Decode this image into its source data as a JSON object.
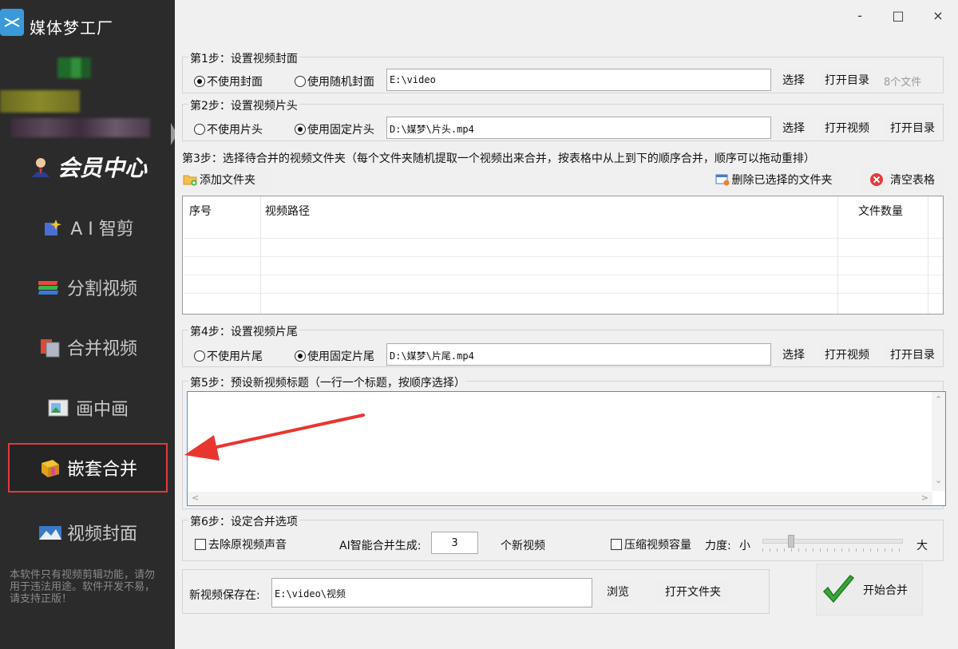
{
  "app": {
    "title": "媒体梦工厂",
    "logo_icon": "scissors-logo-icon"
  },
  "sidebar": {
    "vip_label": "会员中心",
    "items": [
      {
        "label": "A I 智剪",
        "icon": "ai-magic-icon"
      },
      {
        "label": "分割视频",
        "icon": "split-video-icon"
      },
      {
        "label": "合并视频",
        "icon": "merge-video-icon"
      },
      {
        "label": "画中画",
        "icon": "picture-in-picture-icon"
      },
      {
        "label": "嵌套合并",
        "icon": "nested-merge-icon",
        "active": true
      },
      {
        "label": "视频封面",
        "icon": "video-cover-icon"
      }
    ],
    "note": "本软件只有视频剪辑功能，请勿用于违法用途。软件开发不易，请支持正版！"
  },
  "window_controls": {
    "minimize": "-",
    "maximize": "□",
    "close": "×"
  },
  "step1": {
    "legend": "第1步：设置视频封面",
    "option_none": "不使用封面",
    "option_random": "使用随机封面",
    "selected": "option_none",
    "path": "E:\\video",
    "select_label": "选择",
    "open_dir_label": "打开目录",
    "file_count_hint": "8个文件"
  },
  "step2": {
    "legend": "第2步：设置视频片头",
    "option_none": "不使用片头",
    "option_fixed": "使用固定片头",
    "selected": "option_fixed",
    "path": "D:\\媒梦\\片头.mp4",
    "select_label": "选择",
    "open_video_label": "打开视频",
    "open_dir_label": "打开目录"
  },
  "step3": {
    "label": "第3步：选择待合并的视频文件夹（每个文件夹随机提取一个视频出来合并，按表格中从上到下的顺序合并，顺序可以拖动重排）",
    "add_folder_label": "添加文件夹",
    "delete_selected_label": "删除已选择的文件夹",
    "clear_table_label": "清空表格",
    "table": {
      "columns": [
        "序号",
        "视频路径",
        "文件数量"
      ],
      "rows": []
    }
  },
  "step4": {
    "legend": "第4步：设置视频片尾",
    "option_none": "不使用片尾",
    "option_fixed": "使用固定片尾",
    "selected": "option_fixed",
    "path": "D:\\媒梦\\片尾.mp4",
    "select_label": "选择",
    "open_video_label": "打开视频",
    "open_dir_label": "打开目录"
  },
  "step5": {
    "legend": "第5步：预设新视频标题（一行一个标题，按顺序选择）",
    "titles_text": ""
  },
  "step6": {
    "legend": "第6步：设定合并选项",
    "remove_audio_label": "去除原视频声音",
    "remove_audio_checked": false,
    "ai_generate_label": "AI智能合并生成:",
    "ai_generate_count": "3",
    "ai_generate_suffix": "个新视频",
    "compress_label": "压缩视频容量",
    "compress_checked": false,
    "strength_label": "力度:",
    "strength_min_label": "小",
    "strength_max_label": "大",
    "strength_value": 0.22
  },
  "output": {
    "save_label": "新视频保存在:",
    "save_path": "E:\\video\\视频",
    "browse_label": "浏览",
    "open_folder_label": "打开文件夹"
  },
  "start_button": {
    "label": "开始合并",
    "icon": "checkmark-icon"
  },
  "colors": {
    "sidebar_bg": "#2b2b2b",
    "active_border": "#e03b3b",
    "annotation_arrow": "#e8362f",
    "textarea_border": "#4a90d9"
  }
}
